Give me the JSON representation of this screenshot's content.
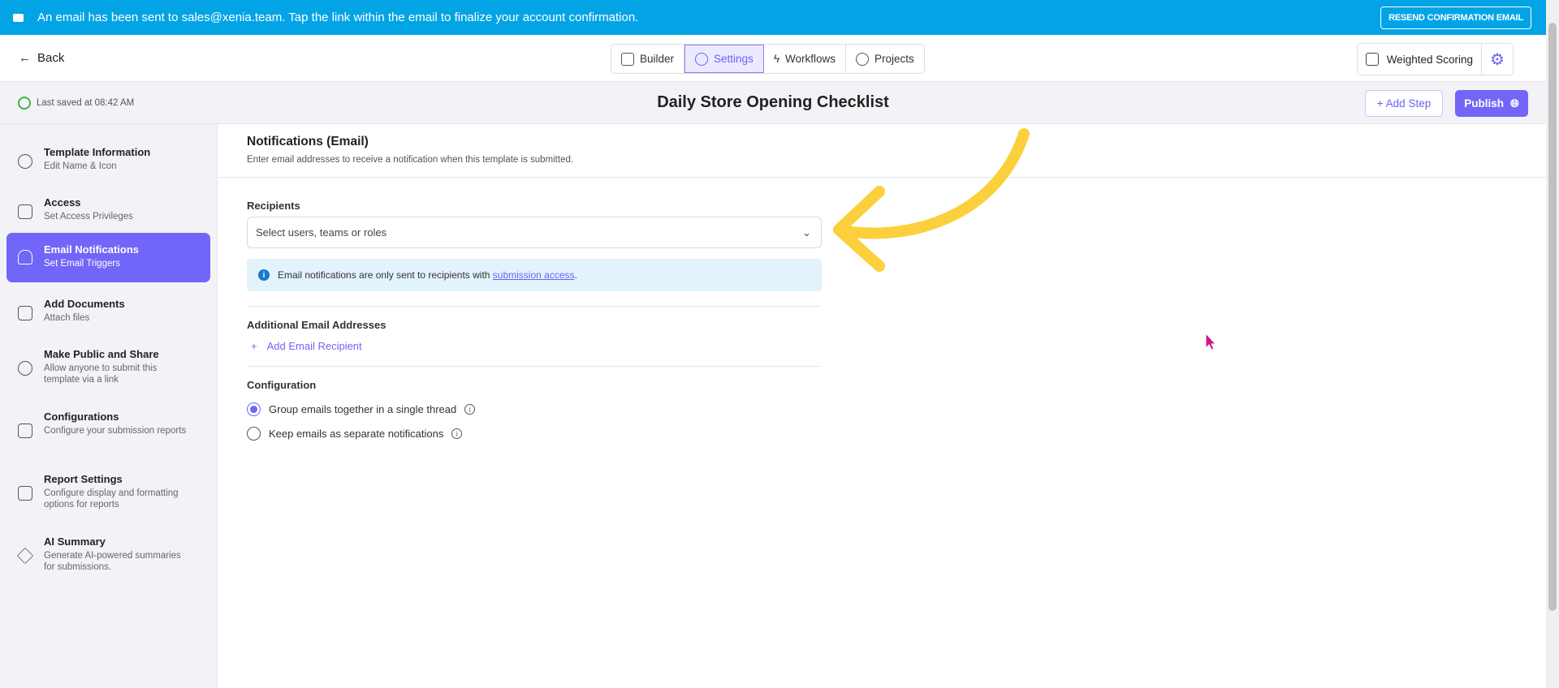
{
  "banner": {
    "message": "An email has been sent to sales@xenia.team. Tap the link within the email to finalize your account confirmation.",
    "resend_label": "RESEND CONFIRMATION EMAIL"
  },
  "header": {
    "back_label": "Back",
    "tabs": [
      {
        "label": "Builder",
        "icon": "pencil-icon"
      },
      {
        "label": "Settings",
        "icon": "gear-icon"
      },
      {
        "label": "Workflows",
        "icon": "lightning-icon"
      },
      {
        "label": "Projects",
        "icon": "clock-icon"
      }
    ],
    "active_tab": "Settings",
    "weighted_scoring_label": "Weighted Scoring",
    "weighted_scoring_checked": false
  },
  "subheader": {
    "last_saved": "Last saved at 08:42 AM",
    "title": "Daily Store Opening Checklist",
    "add_step_label": "+ Add Step",
    "publish_label": "Publish"
  },
  "sidebar": {
    "items": [
      {
        "title": "Template Information",
        "desc": "Edit Name & Icon"
      },
      {
        "title": "Access",
        "desc": "Set Access Privileges"
      },
      {
        "title": "Email Notifications",
        "desc": "Set Email Triggers"
      },
      {
        "title": "Add Documents",
        "desc": "Attach files"
      },
      {
        "title": "Make Public and Share",
        "desc": "Allow anyone to submit this template via a link"
      },
      {
        "title": "Configurations",
        "desc": "Configure your submission reports"
      },
      {
        "title": "Report Settings",
        "desc": "Configure display and formatting options for reports"
      },
      {
        "title": "AI Summary",
        "desc": "Generate AI-powered summaries for submissions."
      }
    ],
    "active_index": 2
  },
  "main": {
    "heading": "Notifications (Email)",
    "description": "Enter email addresses to receive a notification when this template is submitted.",
    "recipients_label": "Recipients",
    "recipients_placeholder": "Select users, teams or roles",
    "info_text": "Email notifications are only sent to recipients with ",
    "info_link": "submission access",
    "info_end": ".",
    "additional_label": "Additional Email Addresses",
    "add_recipient_label": "Add Email Recipient",
    "configuration_label": "Configuration",
    "options": [
      {
        "label": "Group emails together in a single thread",
        "selected": true
      },
      {
        "label": "Keep emails as separate notifications",
        "selected": false
      }
    ]
  },
  "colors": {
    "accent": "#7166f7",
    "banner": "#03a4e6",
    "arrow": "#fcd03c"
  }
}
